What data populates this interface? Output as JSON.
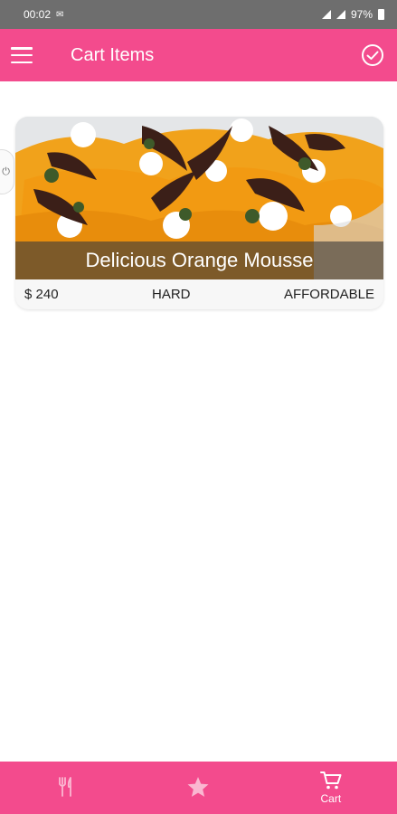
{
  "status_bar": {
    "time": "00:02",
    "battery": "97%"
  },
  "app_bar": {
    "title": "Cart Items"
  },
  "cart": {
    "items": [
      {
        "title": "Delicious Orange Mousse",
        "price": "$ 240",
        "complexity": "HARD",
        "affordability": "AFFORDABLE"
      }
    ]
  },
  "bottom_nav": {
    "tabs": [
      {
        "icon": "utensils-icon",
        "label": ""
      },
      {
        "icon": "star-icon",
        "label": ""
      },
      {
        "icon": "cart-icon",
        "label": "Cart"
      }
    ]
  },
  "colors": {
    "primary": "#f34b8d",
    "status_bar": "#6e6e6e"
  }
}
